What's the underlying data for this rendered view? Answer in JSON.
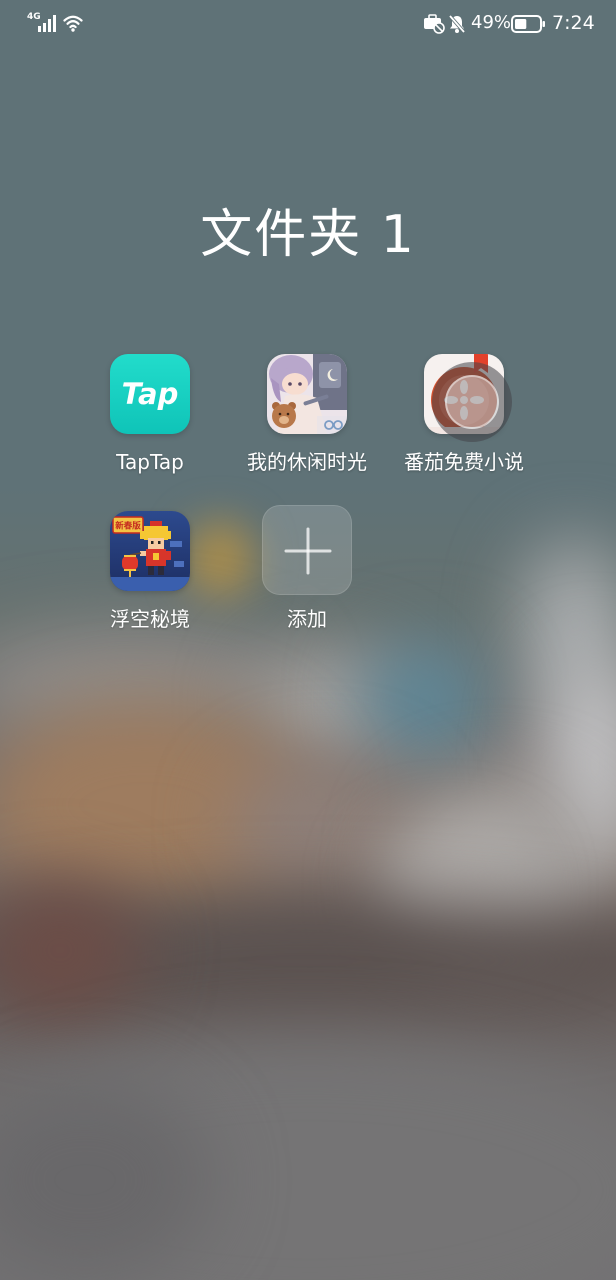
{
  "status_bar": {
    "network_type": "4G",
    "signal_icon": "signal-icon",
    "wifi_icon": "wifi-icon",
    "status_icons": [
      "briefcase-icon",
      "bell-off-icon"
    ],
    "battery_text": "49%",
    "battery_level": 0.49,
    "battery_icon": "battery-icon",
    "time": "7:24"
  },
  "folder": {
    "title": "文件夹 1",
    "apps": [
      {
        "label": "TapTap",
        "icon": "taptap-icon",
        "icon_text": "Tap",
        "color": "#16d0c3"
      },
      {
        "label": "我的休闲时光",
        "icon": "leisure-time-app-icon"
      },
      {
        "label": "番茄免费小说",
        "icon": "tomato-novel-icon",
        "color": "#d8502c"
      },
      {
        "label": "浮空秘境",
        "icon": "floating-realm-icon",
        "badge_text": "新春版"
      },
      {
        "label": "添加",
        "icon": "plus-icon"
      }
    ]
  },
  "floating_button": {
    "icon": "assistive-touch-icon"
  },
  "colors": {
    "background": "#5f7277",
    "text": "#ffffff"
  }
}
